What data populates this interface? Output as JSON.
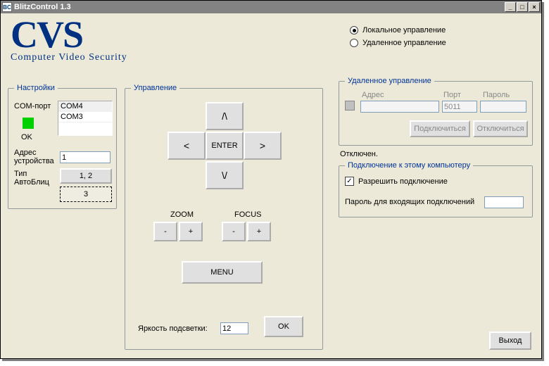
{
  "window": {
    "title": "BlitzControl 1.3",
    "icon_text": "BC"
  },
  "logo": {
    "big": "CVS",
    "sub": "Computer  Video  Security"
  },
  "settings": {
    "legend": "Настройки",
    "comport_label": "COM-порт",
    "com_options": [
      "COM4",
      "COM3"
    ],
    "status_text": "OK",
    "dev_addr_label": "Адрес устройства",
    "dev_addr_value": "1",
    "ab_type_label": "Тип АвтоБлиц",
    "ab_type_btn12": "1, 2",
    "ab_type_btn3": "3"
  },
  "control": {
    "legend": "Управление",
    "up": "/\\",
    "down": "\\/",
    "left": "<",
    "right": ">",
    "enter": "ENTER",
    "zoom_label": "ZOOM",
    "focus_label": "FOCUS",
    "minus": "-",
    "plus": "+",
    "menu": "MENU",
    "brightness_label": "Яркость подсветки:",
    "brightness_value": "12",
    "ok": "OK"
  },
  "mode": {
    "local": "Локальное управление",
    "remote": "Удаленное управление"
  },
  "remote": {
    "legend": "Удаленное управление",
    "addr_label": "Адрес",
    "port_label": "Порт",
    "pass_label": "Пароль",
    "addr_value": "",
    "port_value": "5011",
    "pass_value": "",
    "connect": "Подключиться",
    "disconnect": "Отключиться",
    "status": "Отключен."
  },
  "inbound": {
    "legend": "Подключение к этому компьютеру",
    "allow_label": "Разрешить подключение",
    "pass_label": "Пароль для входящих подключений",
    "pass_value": ""
  },
  "buttons": {
    "exit": "Выход"
  },
  "colors": {
    "brand": "#003081",
    "status_ok": "#00d000"
  }
}
